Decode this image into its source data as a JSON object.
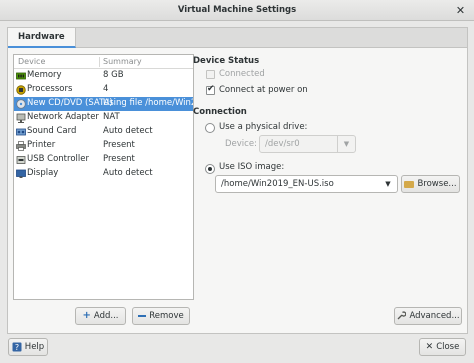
{
  "window": {
    "title": "Virtual Machine Settings"
  },
  "tabs": [
    {
      "label": "Hardware"
    }
  ],
  "device_list": {
    "columns": [
      "Device",
      "Summary"
    ],
    "rows": [
      {
        "name": "Memory",
        "summary": "8 GB",
        "icon": "memory-icon",
        "selected": false
      },
      {
        "name": "Processors",
        "summary": "4",
        "icon": "processor-icon",
        "selected": false
      },
      {
        "name": "New CD/DVD (SATA)",
        "summary": "Using file /home/Win20",
        "icon": "cd-dvd-icon",
        "selected": true
      },
      {
        "name": "Network Adapter",
        "summary": "NAT",
        "icon": "network-adapter-icon",
        "selected": false
      },
      {
        "name": "Sound Card",
        "summary": "Auto detect",
        "icon": "sound-card-icon",
        "selected": false
      },
      {
        "name": "Printer",
        "summary": "Present",
        "icon": "printer-icon",
        "selected": false
      },
      {
        "name": "USB Controller",
        "summary": "Present",
        "icon": "usb-controller-icon",
        "selected": false
      },
      {
        "name": "Display",
        "summary": "Auto detect",
        "icon": "display-icon",
        "selected": false
      }
    ]
  },
  "buttons": {
    "add": "Add...",
    "remove": "Remove",
    "advanced": "Advanced...",
    "browse": "Browse...",
    "help": "Help",
    "close": "Close"
  },
  "device_status": {
    "heading": "Device Status",
    "connected_label": "Connected",
    "connected_checked": false,
    "connected_enabled": false,
    "connect_at_power_on_label": "Connect at power on",
    "connect_at_power_on_checked": true
  },
  "connection": {
    "heading": "Connection",
    "physical_drive_label": "Use a physical drive:",
    "physical_drive_selected": false,
    "device_label": "Device:",
    "device_value": "/dev/sr0",
    "iso_label": "Use ISO image:",
    "iso_selected": true,
    "iso_value": "/home/Win2019_EN-US.iso"
  },
  "colors": {
    "selection": "#4a90d9",
    "background": "#e8e8e7",
    "panel": "#f6f6f5"
  }
}
